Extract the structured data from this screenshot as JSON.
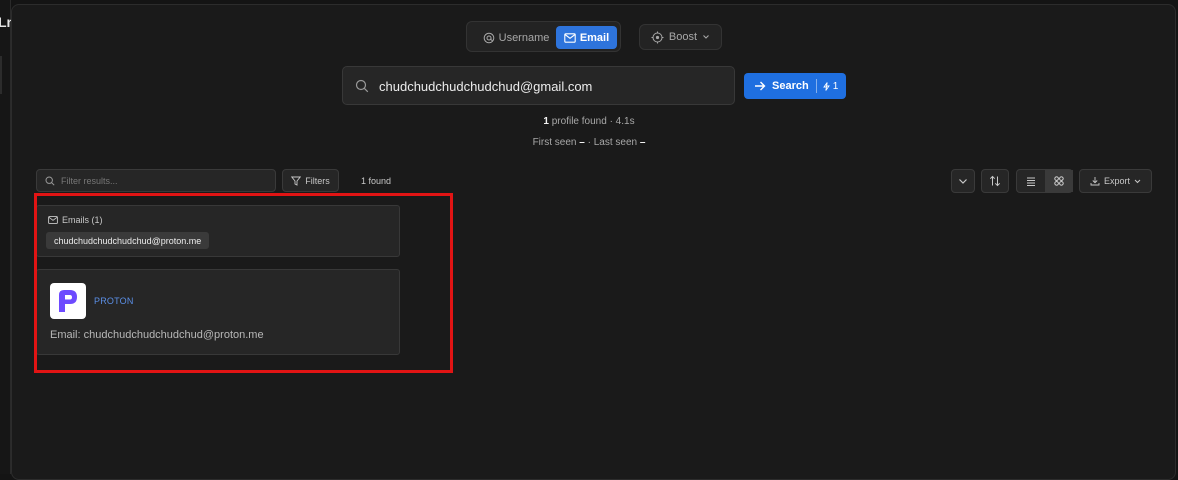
{
  "left_rail": {
    "clipped_text": "Ln"
  },
  "search_modes": {
    "username_label": "Username",
    "email_label": "Email",
    "active": "Email"
  },
  "boost": {
    "label": "Boost"
  },
  "search": {
    "value": "chudchudchudchudchud@gmail.com",
    "button_label": "Search",
    "credit_cost": "1"
  },
  "stats": {
    "profiles_count": "1",
    "profiles_text": "profile found · 4.1s",
    "first_seen_label": "First seen",
    "first_seen_value": "–",
    "separator": "·",
    "last_seen_label": "Last seen",
    "last_seen_value": "–"
  },
  "toolbar": {
    "filter_placeholder": "Filter results...",
    "filters_label": "Filters",
    "found_text": "1 found",
    "export_label": "Export"
  },
  "results": {
    "emails": {
      "header": "Emails (1)",
      "items": [
        "chudchudchudchudchud@proton.me"
      ]
    },
    "cards": [
      {
        "service": "PROTON",
        "brand_color": "#6d4aff",
        "email_label": "Email:",
        "email_value": "chudchudchudchudchud@proton.me"
      }
    ]
  },
  "colors": {
    "accent": "#1f6fe0",
    "highlight": "#e11414"
  },
  "icons": {
    "username": "at-icon",
    "email": "mail-icon",
    "boost": "target-icon",
    "search": "search-icon",
    "filter": "funnel-icon",
    "export": "download-icon"
  }
}
